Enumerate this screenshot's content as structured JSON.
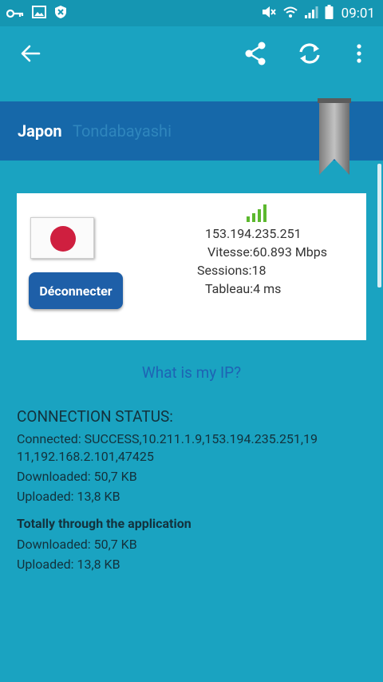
{
  "status_bar": {
    "time": "09:01",
    "left_icons": [
      "key-icon",
      "image-icon",
      "shield-icon"
    ],
    "right_icons": [
      "mute-icon",
      "wifi-icon",
      "signal-icon",
      "battery-icon"
    ]
  },
  "toolbar": {
    "back_icon": "arrow-left-icon",
    "share_icon": "share-icon",
    "refresh_icon": "refresh-icon",
    "more_icon": "more-vert-icon"
  },
  "location": {
    "country": "Japon",
    "city": "Tondabayashi"
  },
  "server": {
    "ip": "153.194.235.251",
    "speed": "Vitesse:60.893 Mbps",
    "sessions": "Sessions:18",
    "tableau": "Tableau:4 ms",
    "disconnect_label": "Déconnecter"
  },
  "what_is_my_ip": "What is my IP?",
  "connection": {
    "title": "CONNECTION STATUS:",
    "connected_line1": "Connected: SUCCESS,10.211.1.9,153.194.235.251,19",
    "connected_line2": "11,192.168.2.101,47425",
    "downloaded": "Downloaded: 50,7 KB",
    "uploaded": "Uploaded: 13,8 KB"
  },
  "totally": {
    "title": "Totally through the application",
    "downloaded": "Downloaded: 50,7 KB",
    "uploaded": "Uploaded: 13,8 KB"
  },
  "colors": {
    "background": "#1aa3c1",
    "status_bar": "#1596b2",
    "country_bar": "#1668a9",
    "button": "#1e5fa8",
    "signal": "#5cb82e",
    "flag_red": "#cf1f3f"
  }
}
